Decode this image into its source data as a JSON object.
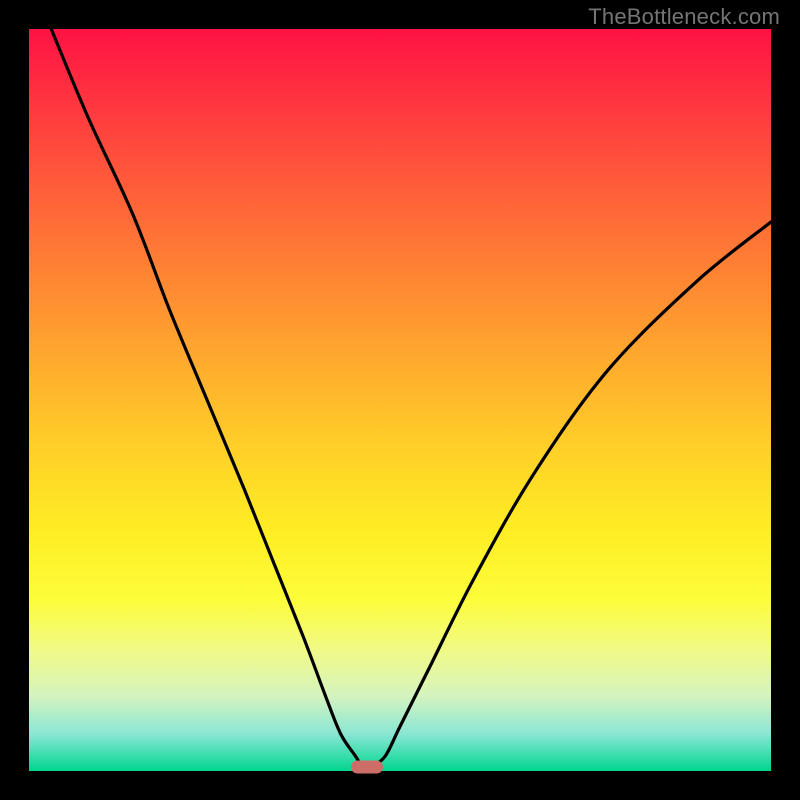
{
  "watermark": "TheBottleneck.com",
  "colors": {
    "frame": "#000000",
    "watermark": "#757575",
    "curve": "#000000",
    "marker": "#cc6d67",
    "gradient_top": "#ff1244",
    "gradient_bottom": "#00d68f"
  },
  "chart_data": {
    "type": "line",
    "title": "",
    "xlabel": "",
    "ylabel": "",
    "xlim": [
      0,
      100
    ],
    "ylim": [
      0,
      100
    ],
    "grid": false,
    "legend": false,
    "series": [
      {
        "name": "bottleneck-curve",
        "x": [
          3,
          8,
          14,
          19,
          24,
          29,
          33,
          37,
          40,
          42,
          44,
          45,
          46,
          48,
          50,
          54,
          60,
          68,
          78,
          90,
          100
        ],
        "y": [
          100,
          88,
          75,
          62,
          50,
          38,
          28,
          18,
          10,
          5,
          2,
          0.5,
          0.5,
          2,
          6,
          14,
          26,
          40,
          54,
          66,
          74
        ]
      }
    ],
    "marker": {
      "x": 45.5,
      "y": 0.5
    }
  }
}
